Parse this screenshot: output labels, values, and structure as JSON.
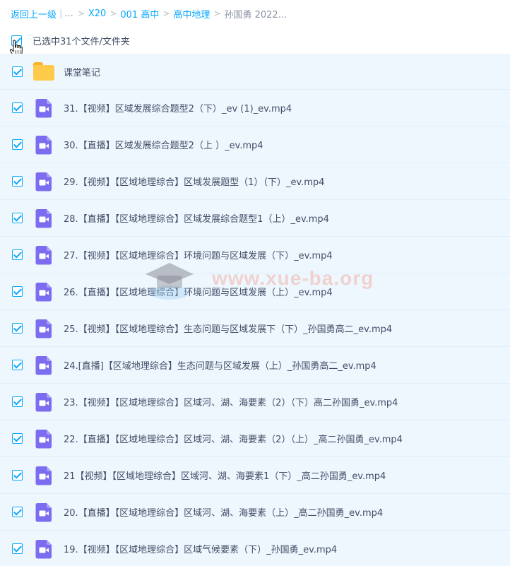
{
  "breadcrumb": {
    "back": "返回上一级",
    "ellipsis": "...",
    "items": [
      "X20",
      "001 高中",
      "高中地理"
    ],
    "current": "孙国勇 2022..."
  },
  "selection": {
    "count_text": "已选中31个文件/文件夹"
  },
  "files": [
    {
      "type": "folder",
      "name": "课堂笔记"
    },
    {
      "type": "video",
      "name": "31.【视频】区域发展综合题型2（下）_ev (1)_ev.mp4"
    },
    {
      "type": "video",
      "name": "30.【直播】区域发展综合题型2（上 ）_ev.mp4"
    },
    {
      "type": "video",
      "name": "29.【视频】【区域地理综合】区域发展题型（1）（下）_ev.mp4"
    },
    {
      "type": "video",
      "name": "28.【直播】【区域地理综合】区域发展综合题型1（上）_ev.mp4"
    },
    {
      "type": "video",
      "name": "27.【视频】【区域地理综合】环境问题与区域发展（下）_ev.mp4"
    },
    {
      "type": "video",
      "name": "26.【直播】【区域地理综合】环境问题与区域发展（上）_ev.mp4"
    },
    {
      "type": "video",
      "name": "25.【视频】【区域地理综合】生态问题与区域发展下（下）_孙国勇高二_ev.mp4"
    },
    {
      "type": "video",
      "name": "24.[直播]【区域地理综合】生态问题与区域发展（上）_孙国勇高二_ev.mp4"
    },
    {
      "type": "video",
      "name": "23.【视频】【区域地理综合】区域河、湖、海要素（2）（下）高二孙国勇_ev.mp4"
    },
    {
      "type": "video",
      "name": "22.【直播】【区域地理综合】区域河、湖、海要素（2）（上）_高二孙国勇_ev.mp4"
    },
    {
      "type": "video",
      "name": "21【视频】【区域地理综合】区域河、湖、海要素1（下）_高二孙国勇_ev.mp4"
    },
    {
      "type": "video",
      "name": "20.【直播】【区域地理综合】区域河、湖、海要素（上）_高二孙国勇_ev.mp4"
    },
    {
      "type": "video",
      "name": "19.【视频】【区域地理综合】区域气候要素（下）_孙国勇_ev.mp4"
    }
  ],
  "watermark": {
    "text": "www.xue-ba.org"
  },
  "colors": {
    "accent": "#06a7ff",
    "row_bg": "#eef7fe",
    "video_icon": "#7b6cf0",
    "folder": "#ffc94a"
  }
}
